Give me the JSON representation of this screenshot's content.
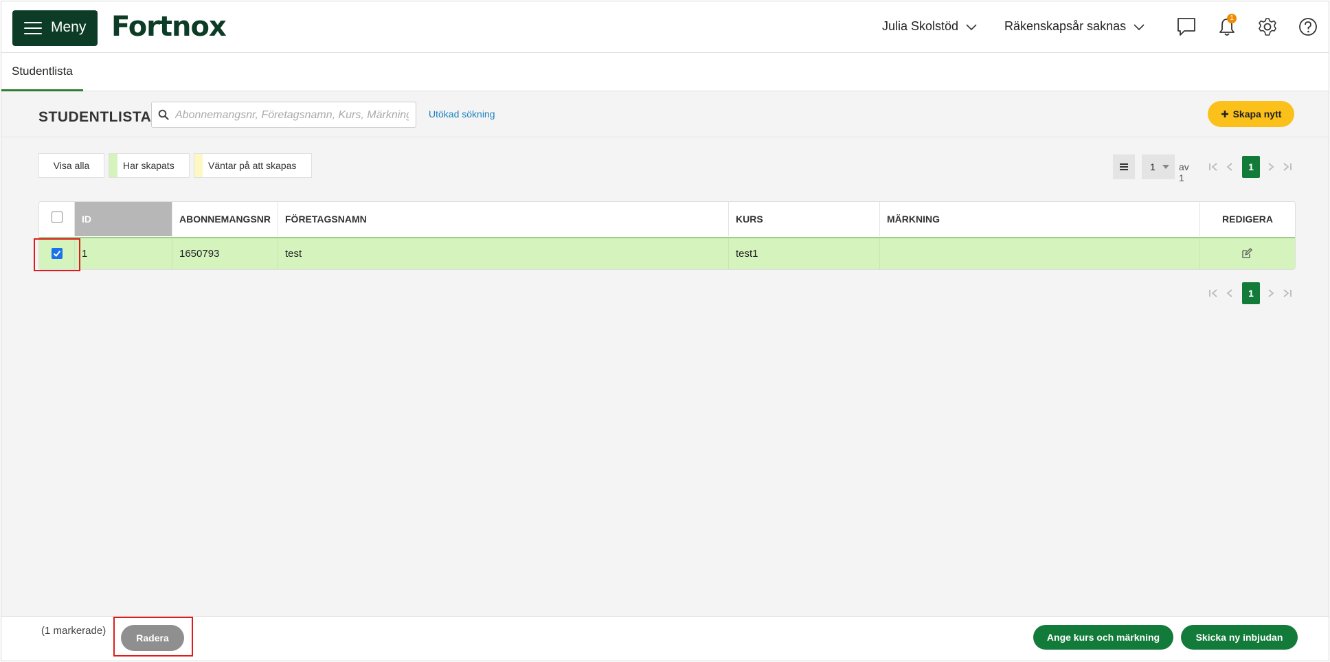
{
  "header": {
    "menu_label": "Meny",
    "logo_text": "Fortnox",
    "user_name": "Julia Skolstöd",
    "fiscal_year": "Räkenskapsår saknas",
    "notification_count": "1",
    "icons": [
      "chat-icon",
      "bell-icon",
      "gear-icon",
      "help-icon"
    ]
  },
  "tabs": [
    {
      "label": "Studentlista",
      "active": true
    }
  ],
  "toolbar": {
    "title": "STUDENTLISTA",
    "search_placeholder": "Abonnemangsnr, Företagsnamn, Kurs, Märkning",
    "advanced_search": "Utökad sökning",
    "create_label": "Skapa nytt"
  },
  "filters": {
    "all": "Visa alla",
    "created": "Har skapats",
    "pending": "Väntar på att skapas"
  },
  "pagination": {
    "per_page_value": "1",
    "of_label": "av 1",
    "current_page": "1"
  },
  "table": {
    "columns": {
      "id": "ID",
      "subscription": "ABONNEMANGSNR",
      "company": "FÖRETAGSNAMN",
      "course": "KURS",
      "marking": "MÄRKNING",
      "edit": "REDIGERA"
    },
    "rows": [
      {
        "id": "1",
        "subscription": "1650793",
        "company": "test",
        "course": "test1",
        "marking": "",
        "selected": true
      }
    ]
  },
  "footer": {
    "selected_count": "(1 markerade)",
    "delete_label": "Radera",
    "set_course_label": "Ange kurs och märkning",
    "resend_label": "Skicka ny inbjudan"
  },
  "colors": {
    "brand_dark_green": "#0c3b26",
    "primary_green": "#137b3a",
    "create_yellow": "#fcc01a",
    "selected_row": "#d4f3bd",
    "pending_yellow": "#fdf8c4",
    "highlight_red": "#e01b1b"
  }
}
